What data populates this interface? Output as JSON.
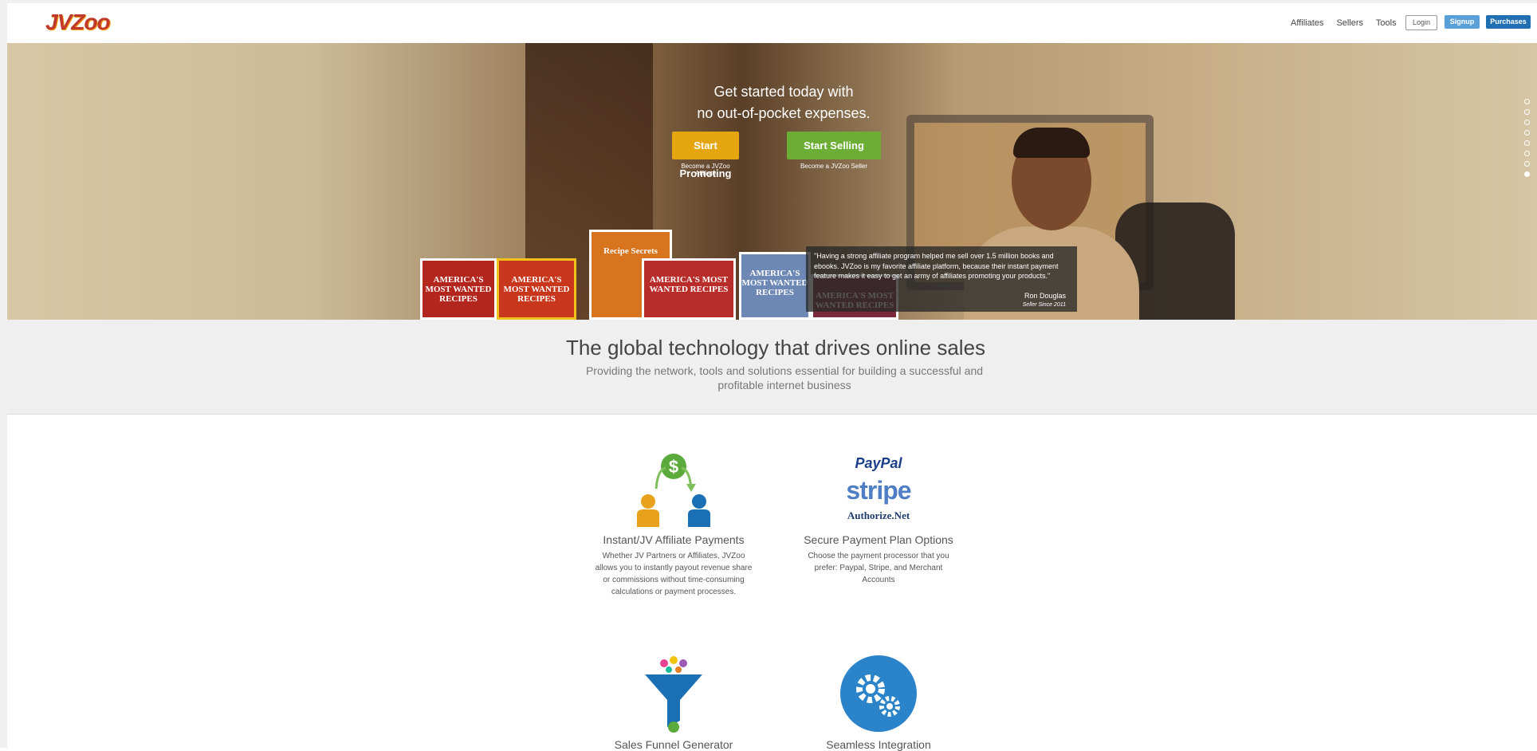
{
  "header": {
    "logo_text": "JVZoo",
    "nav": [
      "Affiliates",
      "Sellers",
      "Tools"
    ],
    "login": "Login",
    "signup": "Signup",
    "purchases": "Purchases"
  },
  "hero": {
    "heading_line1": "Get started today with",
    "heading_line2": "no out-of-pocket expenses.",
    "promote_button": "Start Promoting",
    "promote_sub": "Become a JVZoo Affiliate",
    "sell_button": "Start Selling",
    "sell_sub": "Become a JVZoo Seller",
    "quote": "\"Having a strong affiliate program helped me sell over 1.5 million books and ebooks. JVZoo is my favorite affiliate platform, because their instant payment feature makes it easy to get an army of affiliates promoting your products.\"",
    "quote_name": "Ron Douglas",
    "quote_since": "Seller Since 2011",
    "books": [
      "AMERICA'S MOST WANTED RECIPES",
      "AMERICA'S MOST WANTED RECIPES",
      "Recipe Secrets",
      "AMERICA'S MOST WANTED RECIPES",
      "AMERICA'S MOST WANTED RECIPES",
      "AMERICA'S MOST WANTED RECIPES"
    ],
    "slides_total": 8,
    "active_slide": 8
  },
  "band": {
    "title": "The global technology that drives online sales",
    "subtitle": "Providing the network, tools and solutions essential for building a successful and profitable internet business"
  },
  "features": [
    {
      "title": "Instant/JV Affiliate Payments",
      "desc": "Whether JV Partners or Affiliates, JVZoo allows you to instantly payout revenue share or commissions without time-consuming calculations or payment processes."
    },
    {
      "title": "Secure Payment Plan Options",
      "desc": "Choose the payment processor that you prefer: Paypal, Stripe, and Merchant Accounts",
      "logos": [
        "PayPal",
        "stripe",
        "Authorize.Net"
      ]
    },
    {
      "title": "Sales Funnel Generator"
    },
    {
      "title": "Seamless Integration"
    }
  ],
  "colors": {
    "promote": "#e5a50f",
    "sell": "#6cae35",
    "signup": "#5aa0d8",
    "purchases": "#1f6fb2",
    "accent_blue": "#1a6fb5",
    "accent_orange": "#e8a11c",
    "accent_green": "#5aaa3c"
  }
}
